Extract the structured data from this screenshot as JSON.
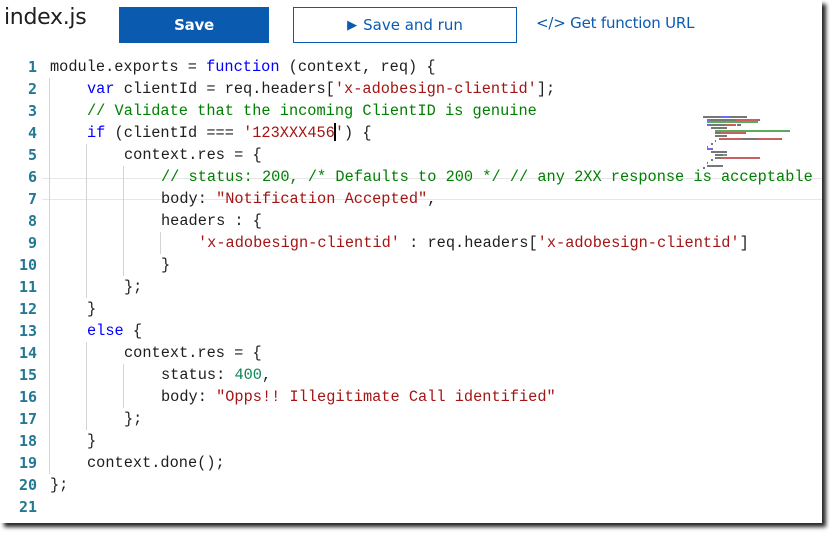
{
  "header": {
    "file_title": "index.js",
    "save_label": "Save",
    "save_and_run_label": "Save and run",
    "save_and_run_icon": "play-icon",
    "get_url_label": "</> Get function URL"
  },
  "editor": {
    "current_line": 4,
    "caret_after": "'123XXX456",
    "lines": [
      {
        "n": "1",
        "indent": 0,
        "tokens": [
          [
            "plain",
            "module.exports = "
          ],
          [
            "kw",
            "function"
          ],
          [
            "plain",
            " (context, req) {"
          ]
        ]
      },
      {
        "n": "2",
        "indent": 1,
        "tokens": [
          [
            "kw",
            "var"
          ],
          [
            "plain",
            " clientId = req.headers["
          ],
          [
            "str",
            "'x-adobesign-clientid'"
          ],
          [
            "plain",
            "];"
          ]
        ]
      },
      {
        "n": "3",
        "indent": 1,
        "tokens": [
          [
            "cm",
            "// Validate that the incoming ClientID is genuine"
          ]
        ]
      },
      {
        "n": "4",
        "indent": 1,
        "tokens": [
          [
            "kw",
            "if"
          ],
          [
            "plain",
            " (clientId === "
          ],
          [
            "str",
            "'123XXX456"
          ],
          [
            "caret",
            ""
          ],
          [
            "str",
            "'"
          ],
          [
            "plain",
            ") {"
          ]
        ]
      },
      {
        "n": "5",
        "indent": 2,
        "tokens": [
          [
            "plain",
            "context.res = {"
          ]
        ]
      },
      {
        "n": "6",
        "indent": 3,
        "tokens": [
          [
            "cm",
            "// status: 200, /* Defaults to 200 */ // any 2XX response is acceptable"
          ]
        ]
      },
      {
        "n": "7",
        "indent": 3,
        "tokens": [
          [
            "plain",
            "body: "
          ],
          [
            "str",
            "\"Notification Accepted\""
          ],
          [
            "plain",
            ","
          ]
        ]
      },
      {
        "n": "8",
        "indent": 3,
        "tokens": [
          [
            "plain",
            "headers : {"
          ]
        ]
      },
      {
        "n": "9",
        "indent": 4,
        "tokens": [
          [
            "str",
            "'x-adobesign-clientid'"
          ],
          [
            "plain",
            " : req.headers["
          ],
          [
            "str",
            "'x-adobesign-clientid'"
          ],
          [
            "plain",
            "]"
          ]
        ]
      },
      {
        "n": "10",
        "indent": 3,
        "tokens": [
          [
            "plain",
            "}"
          ]
        ]
      },
      {
        "n": "11",
        "indent": 2,
        "tokens": [
          [
            "plain",
            "};"
          ]
        ]
      },
      {
        "n": "12",
        "indent": 1,
        "tokens": [
          [
            "plain",
            "}"
          ]
        ]
      },
      {
        "n": "13",
        "indent": 1,
        "tokens": [
          [
            "kw",
            "else"
          ],
          [
            "plain",
            " {"
          ]
        ]
      },
      {
        "n": "14",
        "indent": 2,
        "tokens": [
          [
            "plain",
            "context.res = {"
          ]
        ]
      },
      {
        "n": "15",
        "indent": 3,
        "tokens": [
          [
            "plain",
            "status: "
          ],
          [
            "num",
            "400"
          ],
          [
            "plain",
            ","
          ]
        ]
      },
      {
        "n": "16",
        "indent": 3,
        "tokens": [
          [
            "plain",
            "body: "
          ],
          [
            "str",
            "\"Opps!! Illegitimate Call identified\""
          ]
        ]
      },
      {
        "n": "17",
        "indent": 2,
        "tokens": [
          [
            "plain",
            "};"
          ]
        ]
      },
      {
        "n": "18",
        "indent": 1,
        "tokens": [
          [
            "plain",
            "}"
          ]
        ]
      },
      {
        "n": "19",
        "indent": 1,
        "tokens": [
          [
            "plain",
            "context.done();"
          ]
        ]
      },
      {
        "n": "20",
        "indent": 0,
        "tokens": [
          [
            "plain",
            "};"
          ]
        ]
      },
      {
        "n": "21",
        "indent": 0,
        "tokens": []
      }
    ]
  },
  "colors": {
    "accent": "#0a5bb0",
    "line_number": "#237893",
    "keyword": "#0000ff",
    "string": "#a31515",
    "comment": "#008000",
    "number": "#098658"
  }
}
